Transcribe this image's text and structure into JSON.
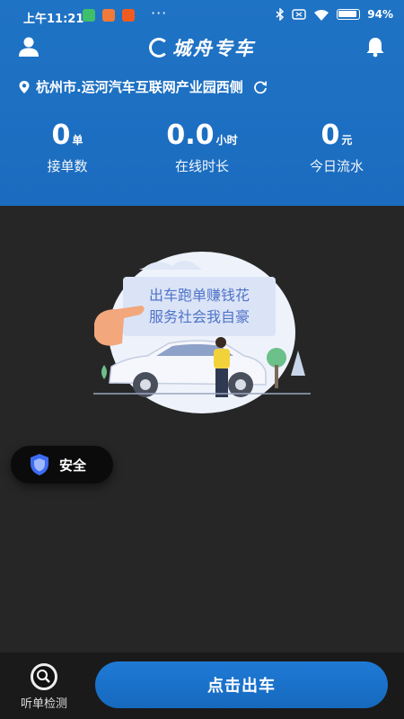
{
  "status_bar": {
    "time": "上午11:21",
    "dots": "···",
    "battery": "94%"
  },
  "header": {
    "title": "城舟专车",
    "location": "杭州市.运河汽车互联网产业园西侧"
  },
  "stats": [
    {
      "value": "0",
      "unit": "单",
      "label": "接单数"
    },
    {
      "value": "0.0",
      "unit": "小时",
      "label": "在线时长"
    },
    {
      "value": "0",
      "unit": "元",
      "label": "今日流水"
    }
  ],
  "banner": {
    "line1": "出车跑单赚钱花",
    "line2": "服务社会我自豪"
  },
  "safety": {
    "label": "安全"
  },
  "bottom": {
    "listen_label": "听单检测",
    "start_button": "点击出车"
  },
  "colors": {
    "header_blue": "#1f73c4",
    "button_blue": "#1b72cc",
    "background": "#262626"
  }
}
